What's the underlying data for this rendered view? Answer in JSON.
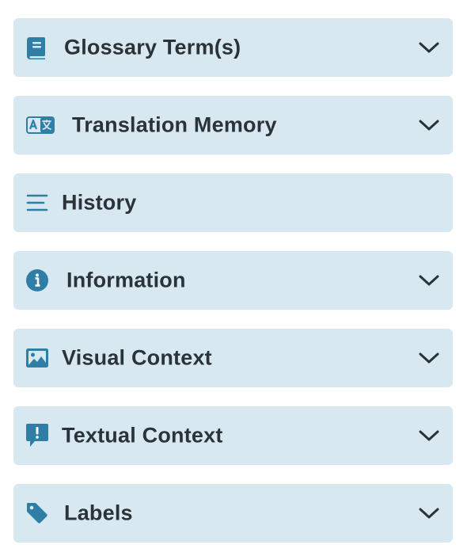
{
  "colors": {
    "panel_background": "#d7e8f1",
    "icon": "#2f7ea6",
    "label": "#2b3338",
    "chevron": "#2b3338"
  },
  "panels": [
    {
      "label": "Glossary Term(s)",
      "icon": "book-icon",
      "expandable": true
    },
    {
      "label": "Translation Memory",
      "icon": "translate-icon",
      "expandable": true
    },
    {
      "label": "History",
      "icon": "list-lines-icon",
      "expandable": false
    },
    {
      "label": "Information",
      "icon": "info-circle-icon",
      "expandable": true
    },
    {
      "label": "Visual Context",
      "icon": "image-icon",
      "expandable": true
    },
    {
      "label": "Textual Context",
      "icon": "speech-alert-icon",
      "expandable": true
    },
    {
      "label": "Labels",
      "icon": "tag-icon",
      "expandable": true
    }
  ]
}
